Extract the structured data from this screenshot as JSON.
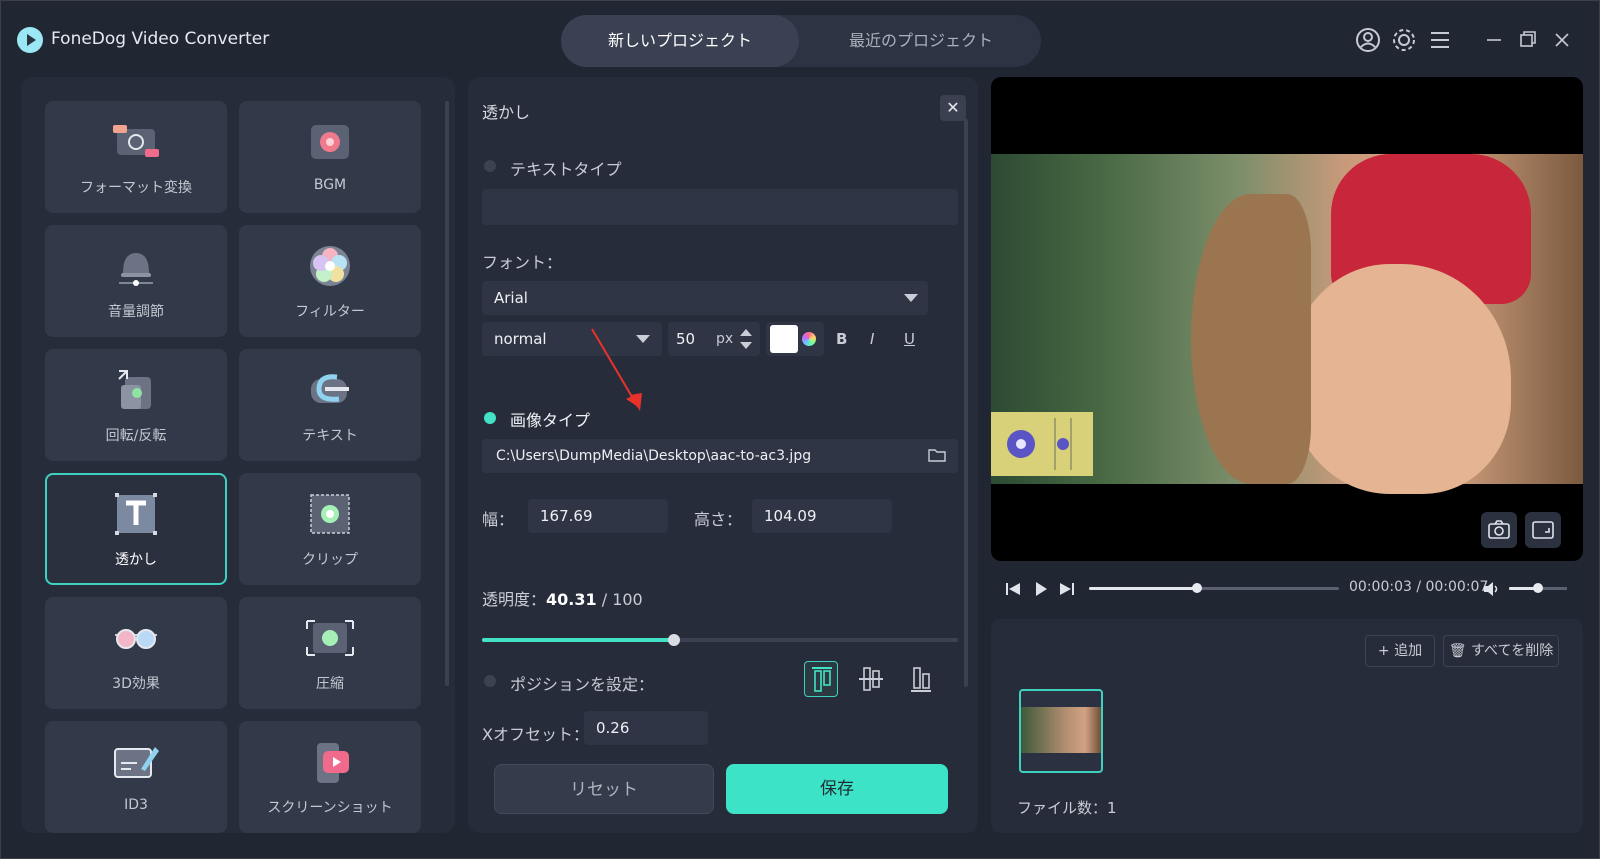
{
  "app": {
    "title": "FoneDog Video Converter"
  },
  "tabs": [
    {
      "label": "新しいプロジェクト",
      "active": true
    },
    {
      "label": "最近のプロジェクト",
      "active": false
    }
  ],
  "top_icons": [
    "account-icon",
    "settings-gear-icon",
    "menu-icon",
    "minimize-icon",
    "restore-icon",
    "close-icon"
  ],
  "tools": [
    {
      "label": "フォーマット変換",
      "icon": "format-convert-icon"
    },
    {
      "label": "BGM",
      "icon": "bgm-icon"
    },
    {
      "label": "音量調節",
      "icon": "volume-bell-icon"
    },
    {
      "label": "フィルター",
      "icon": "filter-icon"
    },
    {
      "label": "回転/反転",
      "icon": "rotate-icon"
    },
    {
      "label": "テキスト",
      "icon": "text-icon"
    },
    {
      "label": "透かし",
      "icon": "watermark-icon",
      "active": true
    },
    {
      "label": "クリップ",
      "icon": "clip-icon"
    },
    {
      "label": "3D効果",
      "icon": "3d-glasses-icon"
    },
    {
      "label": "圧縮",
      "icon": "compress-icon"
    },
    {
      "label": "ID3",
      "icon": "id3-icon"
    },
    {
      "label": "スクリーンショット",
      "icon": "screenshot-icon"
    }
  ],
  "watermark": {
    "title": "透かし",
    "text_type_label": "テキストタイプ",
    "text_value": "",
    "font_label": "フォント：",
    "font_family": "Arial",
    "font_style": "normal",
    "font_size": "50",
    "font_unit": "px",
    "text_color": "#ffffff",
    "bold_label": "B",
    "italic_label": "I",
    "underline_label": "U",
    "image_type_label": "画像タイプ",
    "image_path": "C:\\Users\\DumpMedia\\Desktop\\aac-to-ac3.jpg",
    "width_label": "幅：",
    "width_value": "167.69",
    "height_label": "高さ：",
    "height_value": "104.09",
    "opacity_label": "透明度：",
    "opacity_value": "40.31",
    "opacity_max": "/ 100",
    "opacity_fraction": 0.4031,
    "position_label": "ポジションを設定：",
    "x_offset_label": "Xオフセット：",
    "x_offset_value": "0.26",
    "reset_label": "リセット",
    "save_label": "保存"
  },
  "player": {
    "time_current": "00:00:03",
    "time_total": "00:00:07",
    "time_display": "00:00:03 / 00:00:07",
    "progress_fraction": 0.43,
    "volume_fraction": 0.5
  },
  "files": {
    "add_label": "追加",
    "delete_all_label": "すべてを削除",
    "count_label": "ファイル数：1"
  },
  "colors": {
    "accent": "#43e1c5",
    "background": "#212633",
    "panel": "#262c39",
    "tile": "#323948"
  }
}
